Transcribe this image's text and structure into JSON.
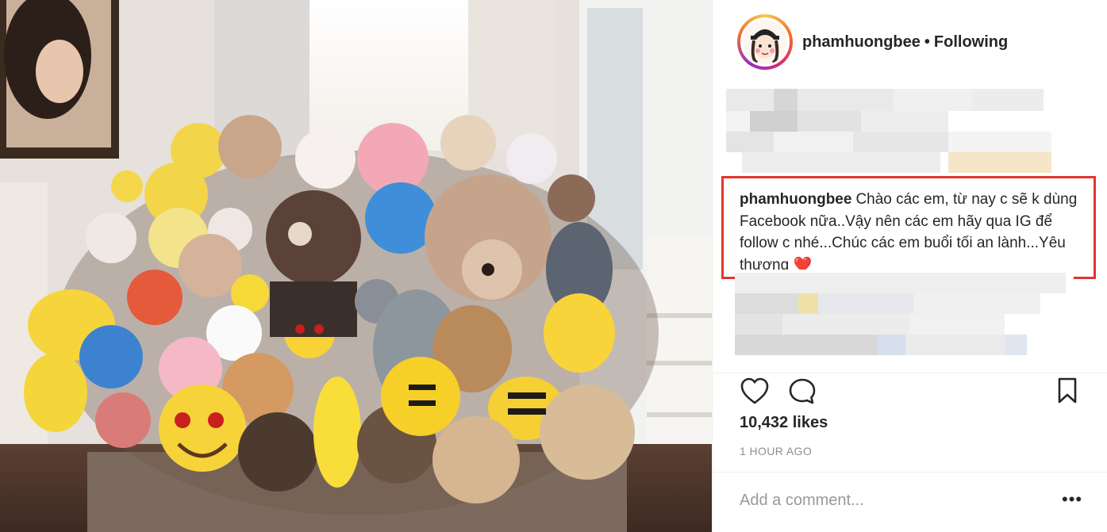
{
  "post": {
    "username": "phamhuongbee",
    "separator": "•",
    "follow_status": "Following",
    "caption_user": "phamhuongbee",
    "caption_text": "Chào các em, từ nay c sẽ k dùng Facebook nữa..Vậy nên các em hãy qua IG để follow c nhé...Chúc các em buổi tối an lành...Yêu thương",
    "caption_emoji": "❤️",
    "likes": "10,432 likes",
    "time_ago": "1 HOUR AGO",
    "comment_placeholder": "Add a comment...",
    "more_glyph": "•••"
  },
  "colors": {
    "highlight_box": "#e3342f",
    "text": "#262626",
    "muted": "#8e8e8e"
  },
  "icons": {
    "like": "heart-icon",
    "comment": "speech-bubble-icon",
    "save": "bookmark-icon",
    "more": "ellipsis-icon"
  }
}
